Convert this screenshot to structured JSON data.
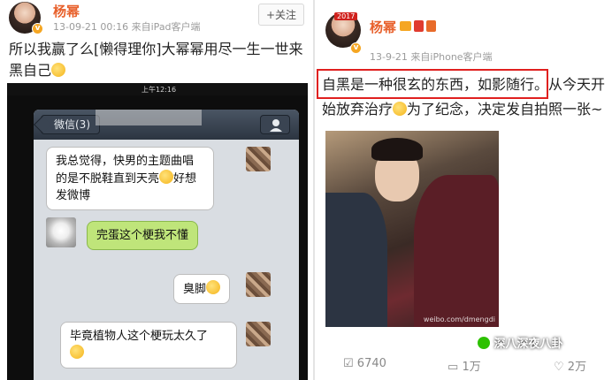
{
  "left_post": {
    "username": "杨幂",
    "meta": "13-09-21 00:16  来自iPad客户端",
    "follow_label": "+关注",
    "text_line1": "所以我赢了么[懒得理你]大幂幂用尽一生一世来",
    "text_line2": "黑自己",
    "chat": {
      "status_time": "上午12:16",
      "back_label": "微信(3)",
      "messages": [
        {
          "line1": "我总觉得，快男的主题曲唱",
          "line2": "的是不脱鞋直到天亮",
          "line2b": "好想",
          "line3": "发微博"
        },
        {
          "text": "完蛋这个梗我不懂"
        },
        {
          "text": "臭脚"
        },
        {
          "line1": "毕竟植物人这个梗玩太久了"
        }
      ]
    }
  },
  "right_post": {
    "username": "杨幂",
    "meta": "13-9-21  来自iPhone客户端",
    "avatar_badge": "2017",
    "highlight_text": "自黑是一种很玄的东西，如影随行。",
    "text_cont1": "从今天开",
    "text_line2a": "始放弃治疗",
    "text_line2b": "为了纪念，决定发自拍照一张~",
    "photo_watermark": "weibo.com/dmengdi",
    "repost_count": "6740",
    "comment_count": "1万",
    "like_count": "2万",
    "source_watermark": "深八深夜八卦"
  },
  "colors": {
    "username": "#e8612c",
    "highlight_border": "#e0201f",
    "green_bubble": "#bfe57a"
  }
}
